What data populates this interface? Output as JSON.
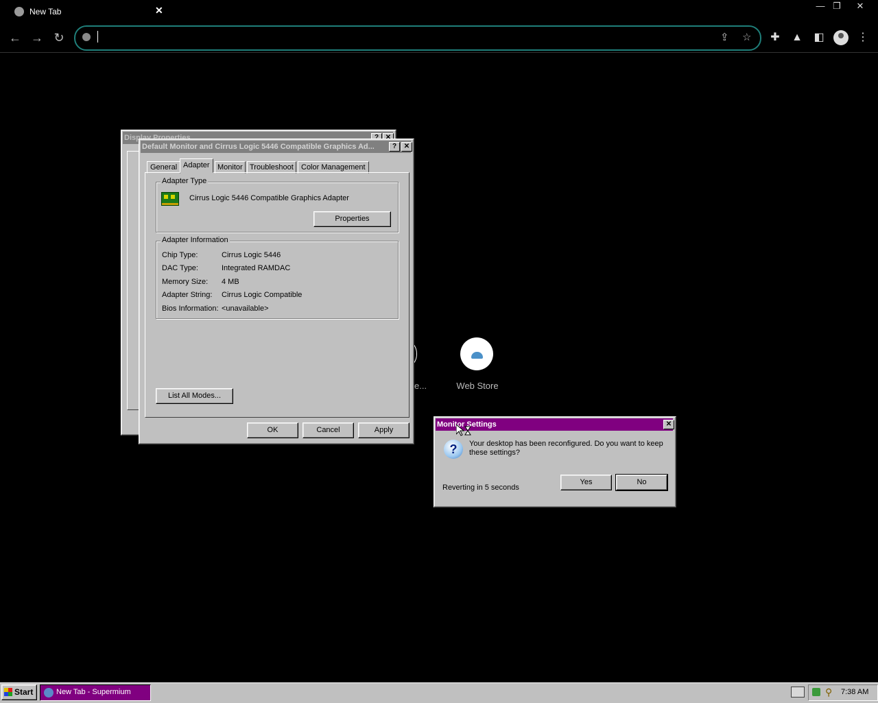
{
  "browser": {
    "tab_title": "New Tab",
    "tab_close": "✕",
    "window_minimize": "—",
    "window_restore": "❐",
    "window_close": "✕"
  },
  "shortcuts": {
    "partial_label": "e...",
    "web_store_label": "Web Store"
  },
  "display_properties": {
    "title": "Display Properties",
    "help": "?",
    "close": "✕"
  },
  "adapter_dialog": {
    "title": "Default Monitor and Cirrus Logic 5446 Compatible Graphics Ad...",
    "help": "?",
    "close": "✕",
    "tabs": [
      "General",
      "Adapter",
      "Monitor",
      "Troubleshoot",
      "Color Management"
    ],
    "active_tab": "Adapter",
    "adapter_type": {
      "group_label": "Adapter Type",
      "name": "Cirrus Logic 5446 Compatible Graphics Adapter",
      "properties_button": "Properties"
    },
    "adapter_info": {
      "group_label": "Adapter Information",
      "rows": [
        {
          "label": "Chip Type:",
          "value": "Cirrus Logic 5446"
        },
        {
          "label": "DAC Type:",
          "value": "Integrated RAMDAC"
        },
        {
          "label": "Memory Size:",
          "value": "4 MB"
        },
        {
          "label": "Adapter String:",
          "value": "Cirrus Logic Compatible"
        },
        {
          "label": "Bios Information:",
          "value": "<unavailable>"
        }
      ]
    },
    "list_modes_button": "List All Modes...",
    "ok_button": "OK",
    "cancel_button": "Cancel",
    "apply_button": "Apply"
  },
  "monitor_settings": {
    "title": "Monitor Settings",
    "close": "✕",
    "message": "Your desktop has been reconfigured.  Do you want to keep these settings?",
    "countdown": "Reverting in 5 seconds",
    "yes_button": "Yes",
    "no_button": "No"
  },
  "taskbar": {
    "start_label": "Start",
    "task_label": "New Tab - Supermium",
    "clock": "7:38 AM",
    "task_color": "#800080"
  }
}
